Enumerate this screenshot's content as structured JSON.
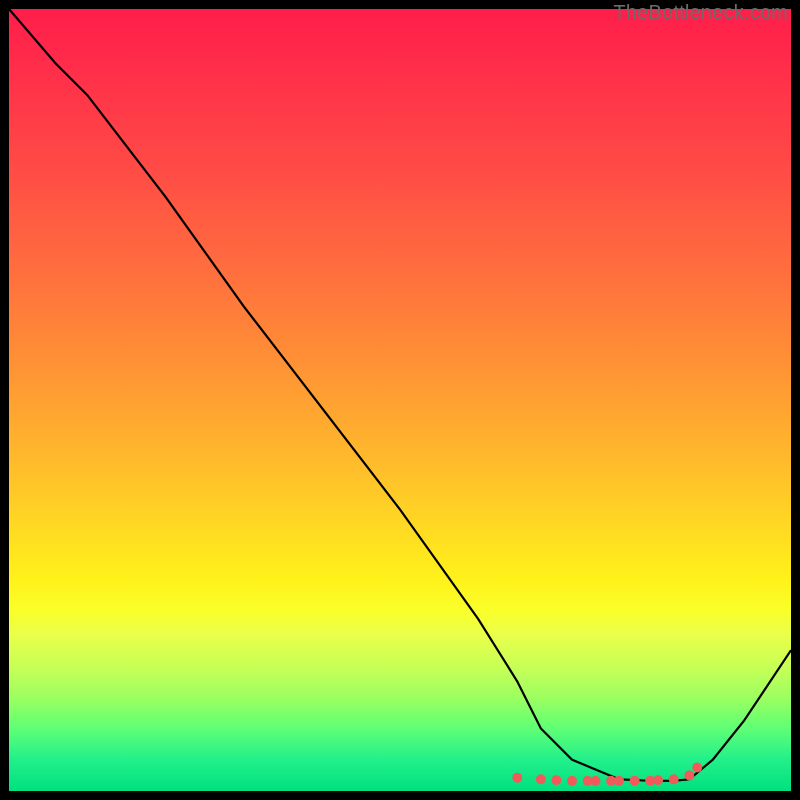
{
  "watermark": "TheBottleneck.com",
  "chart_data": {
    "type": "line",
    "title": "",
    "xlabel": "",
    "ylabel": "",
    "xlim": [
      0,
      100
    ],
    "ylim": [
      0,
      100
    ],
    "series": [
      {
        "name": "curve",
        "x": [
          0,
          6,
          10,
          20,
          30,
          40,
          50,
          60,
          65,
          68,
          72,
          78,
          82,
          85,
          87,
          90,
          94,
          100
        ],
        "y": [
          100,
          93,
          89,
          76,
          62,
          49,
          36,
          22,
          14,
          8,
          4,
          1.5,
          1.3,
          1.3,
          1.5,
          4,
          9,
          18
        ]
      }
    ],
    "markers": {
      "name": "highlight-dots",
      "color": "#f05a5a",
      "x": [
        65,
        68,
        70,
        72,
        74,
        75,
        77,
        78,
        80,
        82,
        83,
        85,
        87,
        88
      ],
      "y": [
        1.7,
        1.5,
        1.4,
        1.3,
        1.3,
        1.3,
        1.3,
        1.3,
        1.3,
        1.3,
        1.4,
        1.5,
        2.0,
        3.0
      ]
    }
  }
}
